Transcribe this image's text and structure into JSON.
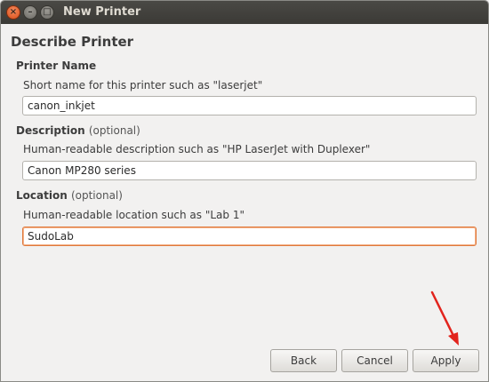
{
  "window": {
    "title": "New Printer",
    "controls": {
      "close": "×",
      "minimize": "–",
      "maximize": "□"
    }
  },
  "page": {
    "heading": "Describe Printer"
  },
  "printer_name": {
    "label": "Printer Name",
    "hint": "Short name for this printer such as \"laserjet\"",
    "value": "canon_inkjet"
  },
  "description": {
    "label": "Description",
    "optional": "(optional)",
    "hint": "Human-readable description such as \"HP LaserJet with Duplexer\"",
    "value": "Canon MP280 series"
  },
  "location": {
    "label": "Location",
    "optional": "(optional)",
    "hint": "Human-readable location such as \"Lab 1\"",
    "value": "SudoLab"
  },
  "buttons": {
    "back": "Back",
    "cancel": "Cancel",
    "apply": "Apply"
  },
  "annotation": {
    "icon": "red-arrow-icon",
    "color": "#e2241d"
  }
}
